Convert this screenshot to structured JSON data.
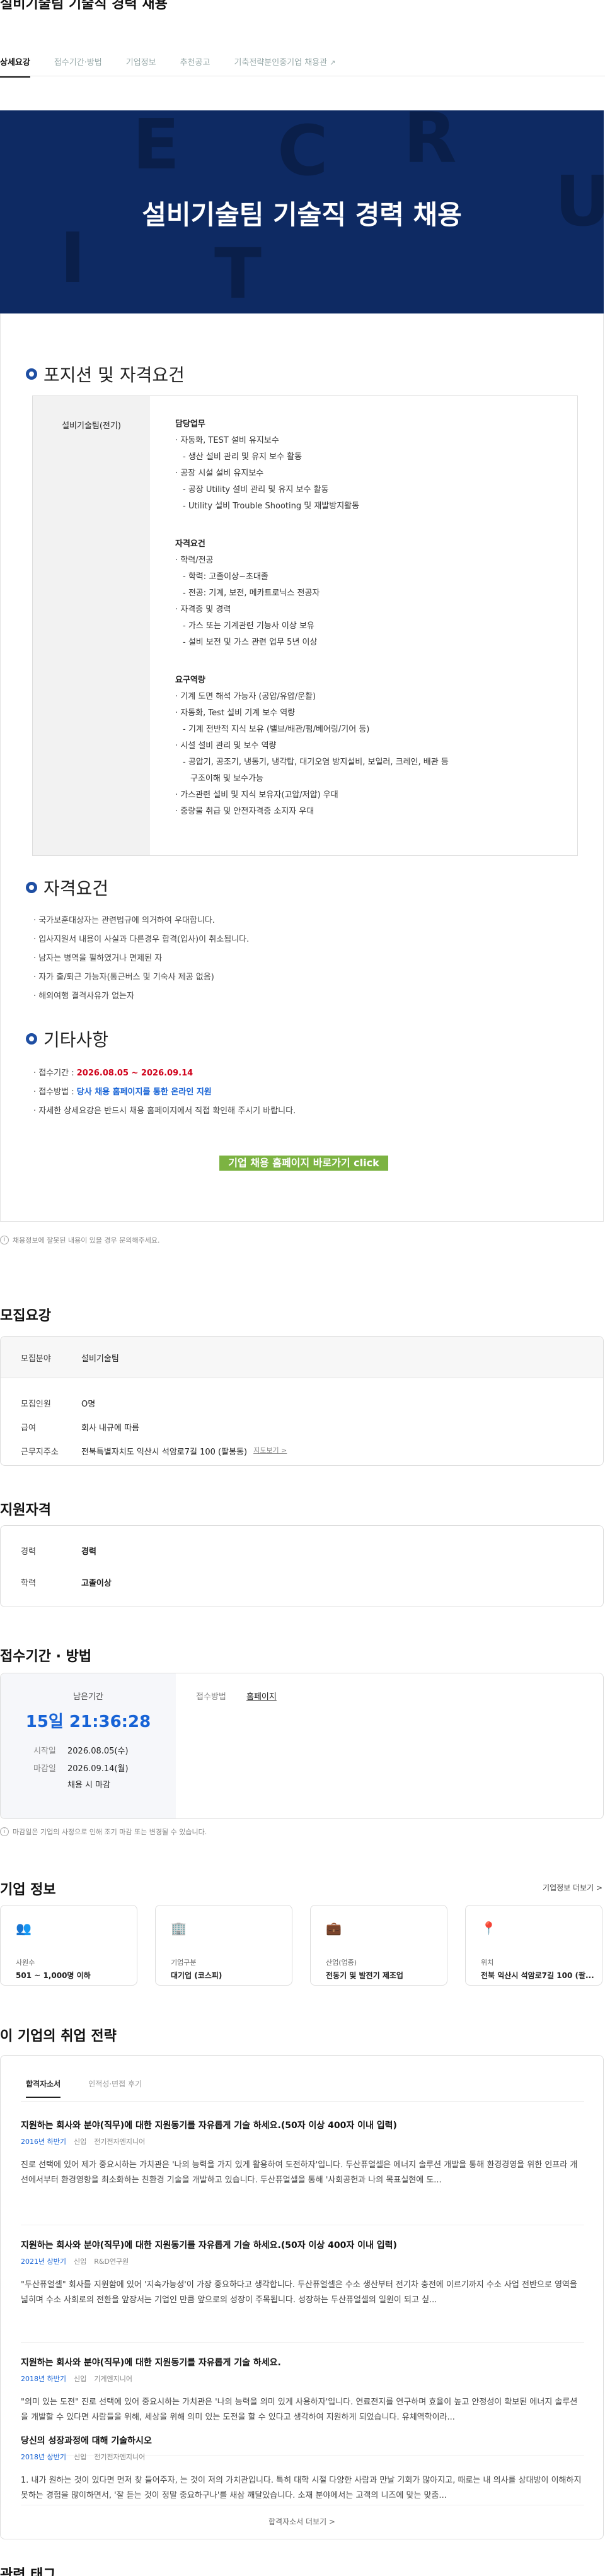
{
  "job": {
    "title": "설비기술팀 기술직 경력 채용"
  },
  "tabs": [
    {
      "label": "상세요강"
    },
    {
      "label": "접수기간·방법"
    },
    {
      "label": "기업정보"
    },
    {
      "label": "추천공고"
    },
    {
      "label": "기축전략분인중기업 채용관"
    }
  ],
  "banner": {
    "title": "설비기술팀 기술직 경력 채용",
    "letters": [
      "E",
      "C",
      "R",
      "U",
      "I",
      "T"
    ]
  },
  "section1": {
    "title": "포지션 및 자격요건",
    "position": "설비기술팀(전기)",
    "groups": [
      {
        "heading": "담당업무",
        "lines": [
          "· 자동화, TEST 설비 유지보수",
          "  - 생산 설비 관리 및 유지 보수 활동",
          "· 공장 시설 설비 유지보수",
          "  - 공장 Utility 설비 관리 및 유지 보수 활동",
          "  - Utility 설비 Trouble Shooting 및 재발방지활동"
        ]
      },
      {
        "heading": "자격요건",
        "lines": [
          "· 학력/전공",
          "  - 학력: 고졸이상~초대졸",
          "  - 전공: 기계, 보전, 메카트로닉스 전공자",
          "· 자격증 및 경력",
          "  - 가스 또는 기계관련 기능사 이상 보유",
          "  - 설비 보전 및 가스 관련 업무 5년 이상"
        ]
      },
      {
        "heading": "요구역량",
        "lines": [
          "· 기계 도면 해석 가능자 (공압/유압/운활)",
          "· 자동화, Test 설비 기계 보수 역량",
          "  - 기계 전반적 지식 보유 (밸브/배관/펌/베어링/기어 등)",
          "· 시설 설비 관리 및 보수 역량",
          "  - 공압기, 공조기, 냉동기, 냉각탑, 대기오염 방지설비, 보일러, 크레인, 배관 등",
          "    구조이해 및 보수가능",
          "· 가스관련 설비 및 지식 보유자(고압/저압) 우대",
          "· 중량물 취급 및 안전자격증 소지자 우대"
        ]
      }
    ]
  },
  "section2": {
    "title": "자격요건",
    "items": [
      "· 국가보훈대상자는 관련법규에 의거하여 우대합니다.",
      "· 입사지원서 내용이 사실과 다른경우 합격(입사)이 취소됩니다.",
      "· 남자는 병역을 필하였거나 면제된 자",
      "· 자가 출/퇴근 가능자(통근버스 및 기숙사 제공 없음)",
      "· 해외여행 결격사유가 없는자"
    ]
  },
  "section3": {
    "title": "기타사항",
    "period_label": "· 접수기간 : ",
    "period_value": "2026.08.05 ~ 2026.09.14",
    "method_label": "· 접수방법 : ",
    "method_value": "당사 채용 홈페이지를 통한 온라인 지원",
    "note": "· 자세한 상세요강은 반드시 채용 홈페이지에서 직접 확인해 주시기 바랍니다."
  },
  "cta": {
    "label": "기업 채용 홈페이지 바로가기 click"
  },
  "report_note": "채용정보에 잘못된 내용이 있을 경우 문의해주세요.",
  "recruit": {
    "title": "모집요강",
    "field_label": "모집분야",
    "field_value": "설비기술팀",
    "count_label": "모집인원",
    "count_value": "O명",
    "pay_label": "급여",
    "pay_value": "회사 내규에 따름",
    "addr_label": "근무지주소",
    "addr_value": "전북특별자치도 익산시 석암로7길 100 (팔봉동)",
    "map_link": "지도보기 >"
  },
  "qualify": {
    "title": "지원자격",
    "career_label": "경력",
    "career_value": "경력",
    "edu_label": "학력",
    "edu_value": "고졸이상"
  },
  "apply": {
    "title": "접수기간 · 방법",
    "remain_label": "남은기간",
    "remain_value": "15일 21:36:28",
    "start_label": "시작일",
    "start_value": "2026.08.05(수)",
    "end_label": "마감일",
    "end_value": "2026.09.14(월)",
    "end_note": "채용 시 마감",
    "method_label": "접수방법",
    "method_value": "홈페이지",
    "note": "마감일은 기업의 사정으로 인해 조기 마감 또는 변경될 수 있습니다."
  },
  "company": {
    "title": "기업 정보",
    "more": "기업정보 더보기 >",
    "cards": [
      {
        "icon": "people-icon",
        "label": "사원수",
        "value": "501 ~ 1,000명 이하"
      },
      {
        "icon": "building-icon",
        "label": "기업구분",
        "value": "대기업 (코스피)"
      },
      {
        "icon": "briefcase-icon",
        "label": "산업(업종)",
        "value": "전동기 및 발전기 제조업"
      },
      {
        "icon": "location-icon",
        "label": "위치",
        "value": "전북 익산시 석암로7길 100 (팔..."
      }
    ]
  },
  "strategy": {
    "title": "이 기업의 취업 전략",
    "tabs": [
      "합격자소서",
      "인적성·면접 후기"
    ],
    "articles": [
      {
        "title": "지원하는 회사와 분야(직무)에 대한 지원동기를 자유롭게 기술 하세요.(50자 이상 400자 이내 입력)",
        "year": "2016년 하반기",
        "type": "신입",
        "dept": "전기전자엔지니어",
        "body": "진로 선택에 있어 제가 중요시하는 가치관은 '나의 능력을 가지 있게 활용하여 도전하자'입니다. 두산퓨얼셀은 에너지 솔루션 개발을 통해 환경경영을 위한 인프라 개선에서부터 환경영향을 최소화하는 친환경 기술을 개발하고 있습니다. 두산퓨얼셀을 통해 '사회공헌과 나의 목표실현에 도..."
      },
      {
        "title": "지원하는 회사와 분야(직무)에 대한 지원동기를 자유롭게 기술 하세요.(50자 이상 400자 이내 입력)",
        "year": "2021년 상반기",
        "type": "신입",
        "dept": "R&D연구원",
        "body": "\"두산퓨얼셀\" 회사를 지원함에 있어 '지속가능성'이 가장 중요하다고 생각합니다. 두산퓨얼셀은 수소 생산부터 전기차 충전에 이르기까지 수소 사업 전반으로 영역을 넓히며 수소 사회로의 전환을 앞장서는 기업인 만큼 앞으로의 성장이 주목됩니다. 성장하는 두산퓨얼셀의 일원이 되고 싶..."
      },
      {
        "title": "지원하는 회사와 분야(직무)에 대한 지원동기를 자유롭게 기술 하세요.",
        "year": "2018년 하반기",
        "type": "신입",
        "dept": "기계엔지니어",
        "body": "\"의미 있는 도전\" 진로 선택에 있어 중요시하는 가치관은 '나의 능력을 의미 있게 사용하자'입니다. 연료전지를 연구하며 효율이 높고 안정성이 확보된 에너지 솔루션을 개발할 수 있다면 사람들을 위해, 세상을 위해 의미 있는 도전을 할 수 있다고 생각하여 지원하게 되었습니다. 유체역학이라..."
      },
      {
        "title": "당신의 성장과정에 대해 기술하시오",
        "year": "2018년 상반기",
        "type": "신입",
        "dept": "전기전자엔지니어",
        "body": "1. 내가 원하는 것이 있다면 먼저 찾 들어주자, 는 것이 저의 가치관입니다. 특히 대학 시절 다양한 사람과 만날 기회가 많아지고, 때로는 내 의사를 상대방이 이해하지 못하는 경험을 많이하면서, '잘 듣는 것이 정말 중요하구나'를 새삼 깨달았습니다. 소재 분야에서는 고객의 니즈에 맞는 맞춤..."
      }
    ],
    "more": "합격자소서 더보기 >"
  },
  "related": {
    "title": "관련 태그"
  }
}
